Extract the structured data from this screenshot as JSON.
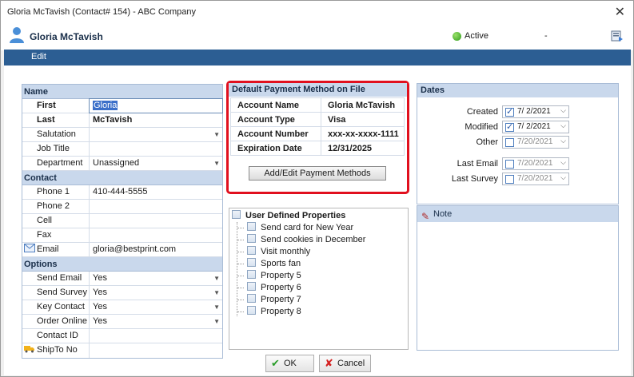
{
  "window": {
    "title": "Gloria McTavish  (Contact# 154)  -  ABC Company",
    "close_glyph": "✕"
  },
  "header": {
    "name": "Gloria McTavish",
    "status": "Active",
    "dash": "-",
    "status_color": "#2f9d1b",
    "icons": [
      "person-icon",
      "export-icon"
    ]
  },
  "menu": {
    "edit_label": "Edit"
  },
  "grid": {
    "sections": {
      "name": "Name",
      "contact": "Contact",
      "options": "Options"
    },
    "name_rows": [
      {
        "label": "First",
        "value": "Gloria"
      },
      {
        "label": "Last",
        "value": "McTavish"
      },
      {
        "label": "Salutation",
        "value": ""
      },
      {
        "label": "Job Title",
        "value": ""
      },
      {
        "label": "Department",
        "value": "Unassigned"
      }
    ],
    "contact_rows": [
      {
        "label": "Phone 1",
        "value": "410-444-5555"
      },
      {
        "label": "Phone 2",
        "value": ""
      },
      {
        "label": "Cell",
        "value": ""
      },
      {
        "label": "Fax",
        "value": ""
      },
      {
        "label": "Email",
        "value": "gloria@bestprint.com"
      }
    ],
    "options_rows": [
      {
        "label": "Send Email",
        "value": "Yes"
      },
      {
        "label": "Send Survey",
        "value": "Yes"
      },
      {
        "label": "Key Contact",
        "value": "Yes"
      },
      {
        "label": "Order Online",
        "value": "Yes"
      },
      {
        "label": "Contact ID",
        "value": ""
      },
      {
        "label": "ShipTo No",
        "value": ""
      }
    ]
  },
  "payment": {
    "title": "Default Payment Method on File",
    "rows": [
      {
        "label": "Account Name",
        "value": "Gloria McTavish"
      },
      {
        "label": "Account Type",
        "value": "Visa"
      },
      {
        "label": "Account Number",
        "value": "xxx-xx-xxxx-1111"
      },
      {
        "label": "Expiration Date",
        "value": "12/31/2025"
      }
    ],
    "button_label": "Add/Edit Payment Methods",
    "highlight_color": "#e1101e"
  },
  "udp": {
    "title": "User Defined Properties",
    "items": [
      "Send card for New Year",
      "Send cookies in December",
      "Visit monthly",
      "Sports fan",
      "Property 5",
      "Property 6",
      "Property 7",
      "Property 8"
    ]
  },
  "dates": {
    "title": "Dates",
    "rows": [
      {
        "label": "Created",
        "value": "7/ 2/2021",
        "checked": true
      },
      {
        "label": "Modified",
        "value": "7/ 2/2021",
        "checked": true
      },
      {
        "label": "Other",
        "value": "7/20/2021",
        "checked": false
      },
      {
        "label": "Last Email",
        "value": "7/20/2021",
        "checked": false
      },
      {
        "label": "Last Survey",
        "value": "7/20/2021",
        "checked": false
      }
    ]
  },
  "note": {
    "title": "Note"
  },
  "buttons": {
    "ok": "OK",
    "cancel": "Cancel"
  }
}
